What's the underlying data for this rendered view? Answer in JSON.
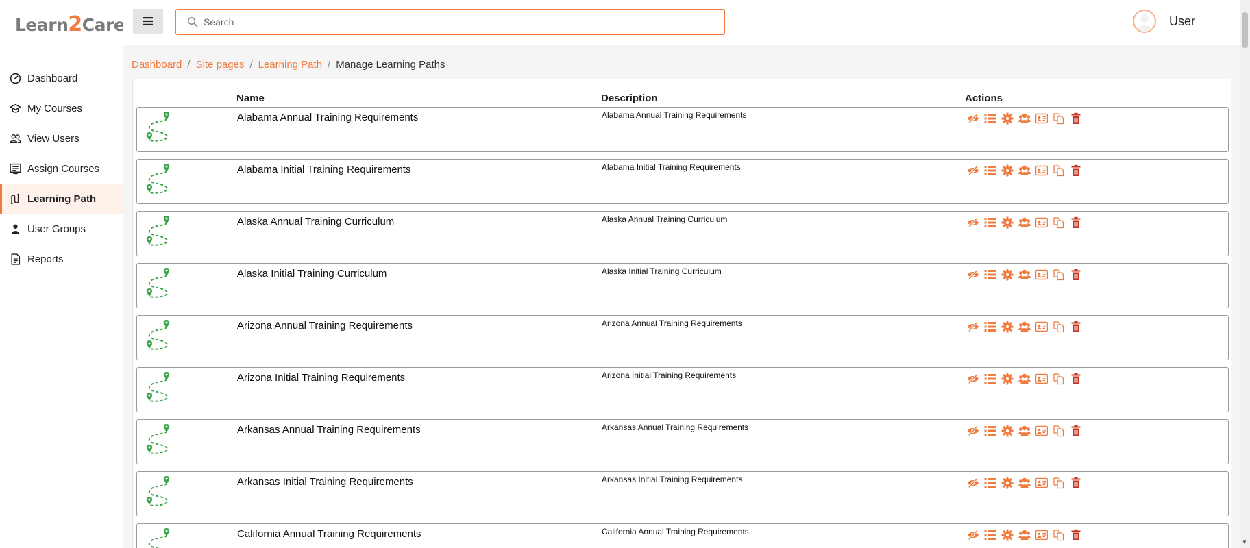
{
  "brand": {
    "logo_left": "Learn",
    "logo_mid": "2",
    "logo_right": "Care"
  },
  "colors": {
    "accent": "#f07b3f",
    "path_green": "#3ea34a",
    "delete_red": "#c0311f"
  },
  "sidebar": {
    "items": [
      {
        "label": "Dashboard",
        "icon": "dashboard-gauge-icon"
      },
      {
        "label": "My Courses",
        "icon": "graduation-cap-icon"
      },
      {
        "label": "View Users",
        "icon": "users-icon"
      },
      {
        "label": "Assign Courses",
        "icon": "list-board-icon"
      },
      {
        "label": "Learning Path",
        "icon": "route-icon",
        "active": true
      },
      {
        "label": "User Groups",
        "icon": "user-icon"
      },
      {
        "label": "Reports",
        "icon": "report-document-icon"
      }
    ]
  },
  "header": {
    "search_placeholder": "Search",
    "user_name": "User"
  },
  "breadcrumb": {
    "items": [
      "Dashboard",
      "Site pages",
      "Learning Path"
    ],
    "current": "Manage Learning Paths"
  },
  "table": {
    "columns": {
      "name": "Name",
      "description": "Description",
      "actions": "Actions"
    },
    "action_icons": [
      "hide-eye-slash-icon",
      "list-icon",
      "settings-gear-icon",
      "users-group-icon",
      "id-card-icon",
      "copy-icon",
      "trash-icon"
    ],
    "rows": [
      {
        "name": "Alabama Annual Training Requirements",
        "description": "Alabama Annual Training Requirements"
      },
      {
        "name": "Alabama Initial Training Requirements",
        "description": "Alabama Initial Training Requirements"
      },
      {
        "name": "Alaska Annual Training Curriculum",
        "description": "Alaska Annual Training Curriculum"
      },
      {
        "name": "Alaska Initial Training Curriculum",
        "description": "Alaska Initial Training Curriculum"
      },
      {
        "name": "Arizona Annual Training Requirements",
        "description": "Arizona Annual Training Requirements"
      },
      {
        "name": "Arizona Initial Training Requirements",
        "description": "Arizona Initial Training Requirements"
      },
      {
        "name": "Arkansas Annual Training Requirements",
        "description": "Arkansas Annual Training Requirements"
      },
      {
        "name": "Arkansas Initial Training Requirements",
        "description": "Arkansas Initial Training Requirements"
      },
      {
        "name": "California Annual Training Requirements",
        "description": "California Annual Training Requirements"
      }
    ]
  }
}
